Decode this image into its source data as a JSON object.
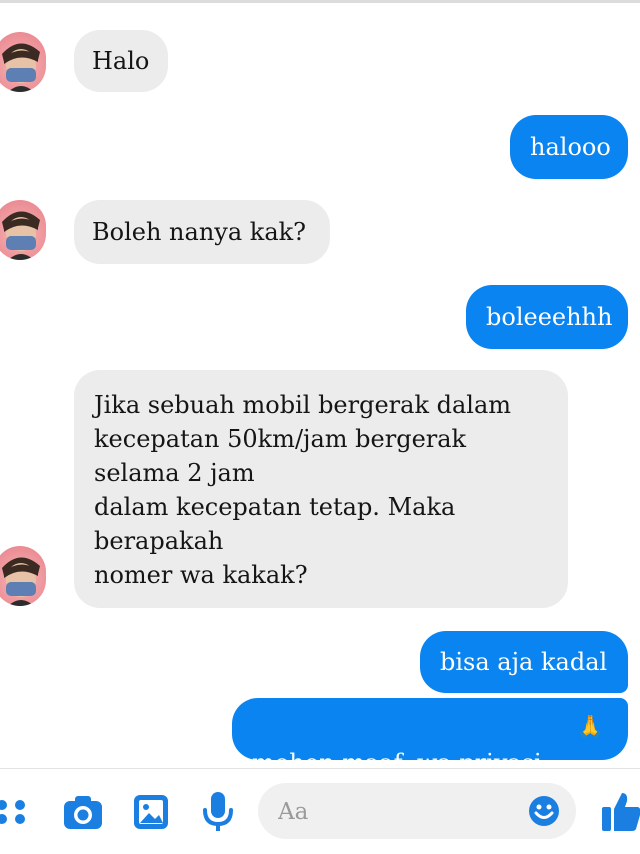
{
  "messages": [
    {
      "side": "incoming",
      "text": "Halo"
    },
    {
      "side": "outgoing",
      "text": "halooo"
    },
    {
      "side": "incoming",
      "text": "Boleh nanya kak?"
    },
    {
      "side": "outgoing",
      "text": "boleeehhh"
    },
    {
      "side": "incoming",
      "text": "Jika sebuah mobil bergerak dalam\nkecepatan 50km/jam bergerak\nselama 2 jam\ndalam kecepatan tetap. Maka\nberapakah\nnomer wa kakak?"
    },
    {
      "side": "outgoing",
      "text": "bisa aja kadal"
    },
    {
      "side": "outgoing",
      "text": "mohon maaf, wa privasi",
      "emoji": "🙏"
    }
  ],
  "composer": {
    "placeholder": "Aa",
    "icons": [
      "more-icon",
      "camera-icon",
      "gallery-icon",
      "microphone-icon",
      "emoji-icon",
      "like-icon"
    ]
  },
  "colors": {
    "outgoing_bubble": "#0a84f0",
    "incoming_bubble": "#ececec",
    "accent": "#1a7fe0"
  }
}
